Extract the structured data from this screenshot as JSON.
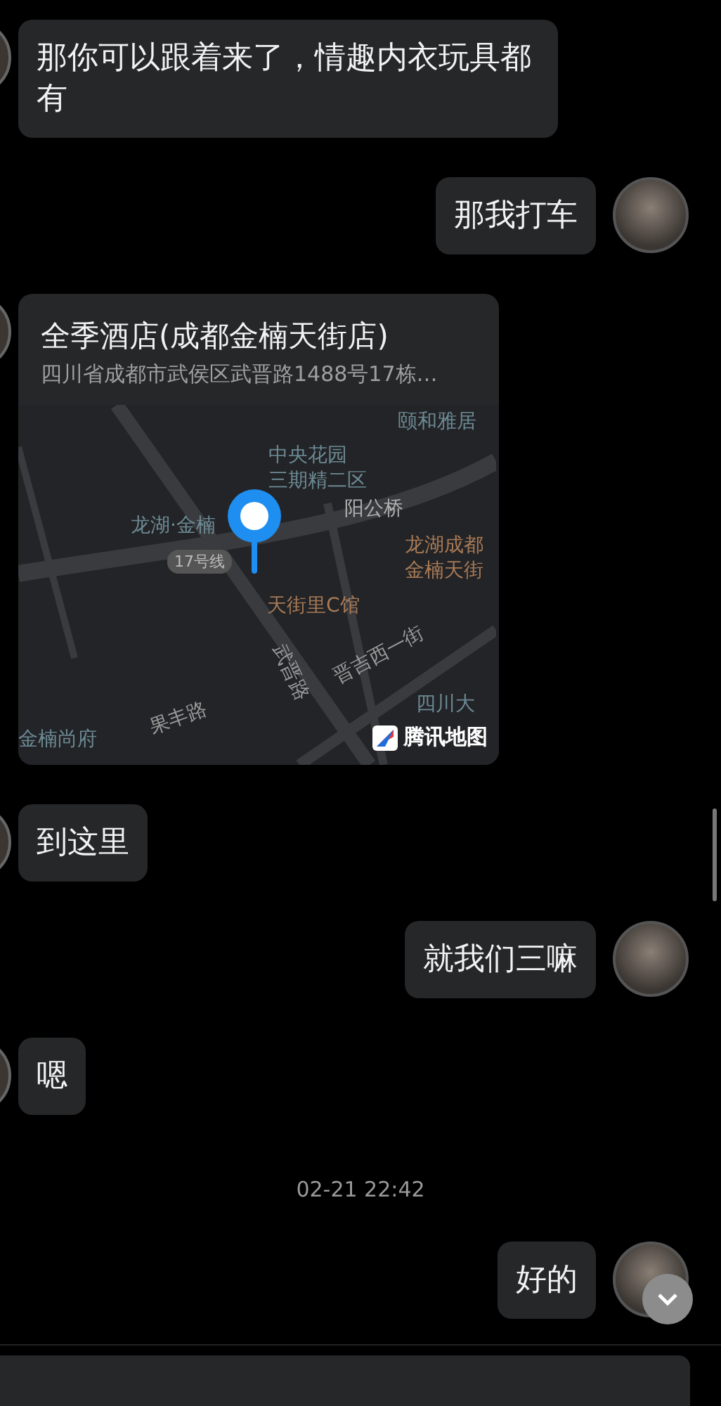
{
  "messages": [
    {
      "kind": "text",
      "outgoing": false,
      "text": "那你可以跟着来了，情趣内衣玩具都有"
    },
    {
      "kind": "text",
      "outgoing": true,
      "text": "那我打车"
    },
    {
      "kind": "location",
      "outgoing": false,
      "title": "全季酒店(成都金楠天街店)",
      "address": "四川省成都市武侯区武晋路1488号17栋…",
      "map_labels": [
        {
          "text": "颐和雅居",
          "kind": "poi"
        },
        {
          "text": "中央花园",
          "kind": "poi"
        },
        {
          "text": "三期精二区",
          "kind": "poi"
        },
        {
          "text": "阳公桥",
          "kind": "place"
        },
        {
          "text": "龙湖·金楠",
          "kind": "poi"
        },
        {
          "text": "17号线",
          "kind": "line"
        },
        {
          "text": "龙湖成都",
          "kind": "shop"
        },
        {
          "text": "金楠天街",
          "kind": "shop"
        },
        {
          "text": "天街里C馆",
          "kind": "shop"
        },
        {
          "text": "武晋路",
          "kind": "road"
        },
        {
          "text": "晋吉西一街",
          "kind": "road"
        },
        {
          "text": "四川大",
          "kind": "poi"
        },
        {
          "text": "金楠尚府",
          "kind": "poi"
        },
        {
          "text": "果丰路",
          "kind": "road"
        }
      ],
      "provider": "腾讯地图"
    },
    {
      "kind": "text",
      "outgoing": false,
      "text": "到这里"
    },
    {
      "kind": "text",
      "outgoing": true,
      "text": "就我们三嘛"
    },
    {
      "kind": "text",
      "outgoing": false,
      "text": "嗯"
    },
    {
      "kind": "time",
      "text": "02-21 22:42"
    },
    {
      "kind": "text",
      "outgoing": true,
      "text": "好的"
    }
  ]
}
